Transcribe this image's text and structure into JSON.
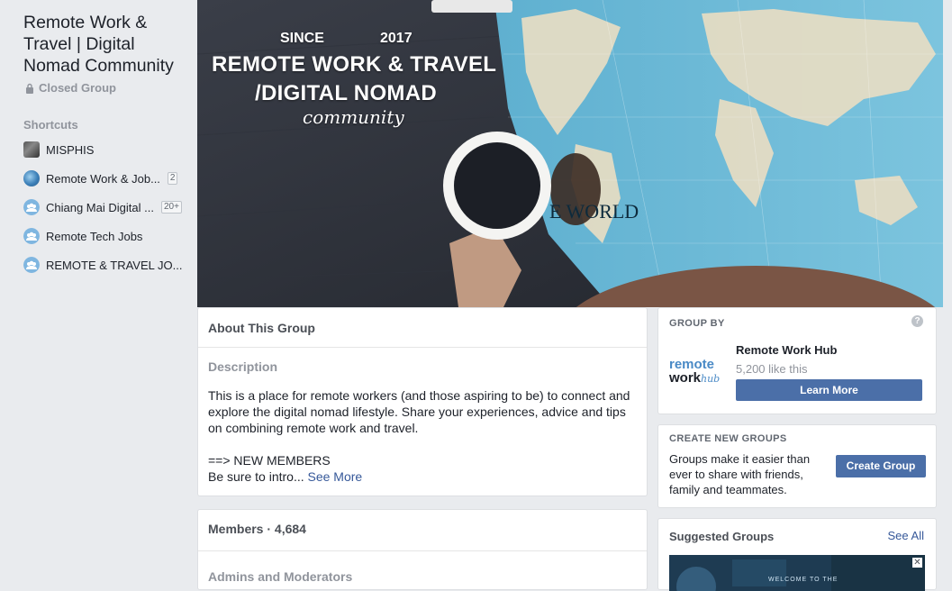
{
  "sidebar": {
    "group_title": "Remote Work & Travel | Digital Nomad Community",
    "privacy": "Closed Group",
    "shortcuts_label": "Shortcuts",
    "shortcuts": [
      {
        "label": "MISPHIS",
        "badge": "",
        "icon": "group-photo-icon"
      },
      {
        "label": "Remote Work & Job...",
        "badge": "2",
        "icon": "globe-icon"
      },
      {
        "label": "Chiang Mai Digital ...",
        "badge": "20+",
        "icon": "group-icon"
      },
      {
        "label": "Remote Tech Jobs",
        "badge": "",
        "icon": "group-icon"
      },
      {
        "label": "REMOTE & TRAVEL JO...",
        "badge": "",
        "icon": "group-icon"
      }
    ]
  },
  "cover": {
    "since": "SINCE",
    "year": "2017",
    "line1": "REMOTE WORK & TRAVEL",
    "line2": "/DIGITAL NOMAD",
    "line3": "community",
    "map_text": "E WORLD"
  },
  "about": {
    "title": "About This Group",
    "description_label": "Description",
    "description_p1": "This is a place for remote workers (and those aspiring to be) to connect and explore the digital nomad lifestyle. Share your experiences, advice and tips on combining remote work and travel.",
    "description_p2": "==> NEW MEMBERS",
    "description_p3": "Be sure to intro...",
    "see_more": "See More"
  },
  "members": {
    "title": "Members · 4,684",
    "admins_label": "Admins and Moderators"
  },
  "group_by": {
    "label": "GROUP BY",
    "logo_line1": "remote",
    "logo_line2a": "work",
    "logo_line2b": "hub",
    "page_name": "Remote Work Hub",
    "likes": "5,200 like this",
    "button": "Learn More"
  },
  "create_groups": {
    "label": "CREATE NEW GROUPS",
    "text": "Groups make it easier than ever to share with friends, family and teammates.",
    "button": "Create Group"
  },
  "suggested": {
    "title": "Suggested Groups",
    "see_all": "See All",
    "thumb_text": "WELCOME TO THE"
  },
  "colors": {
    "page_bg": "#e9ebee",
    "button_blue": "#4b6fa8",
    "link_blue": "#365899",
    "map_sea": "#6ab4d3"
  }
}
